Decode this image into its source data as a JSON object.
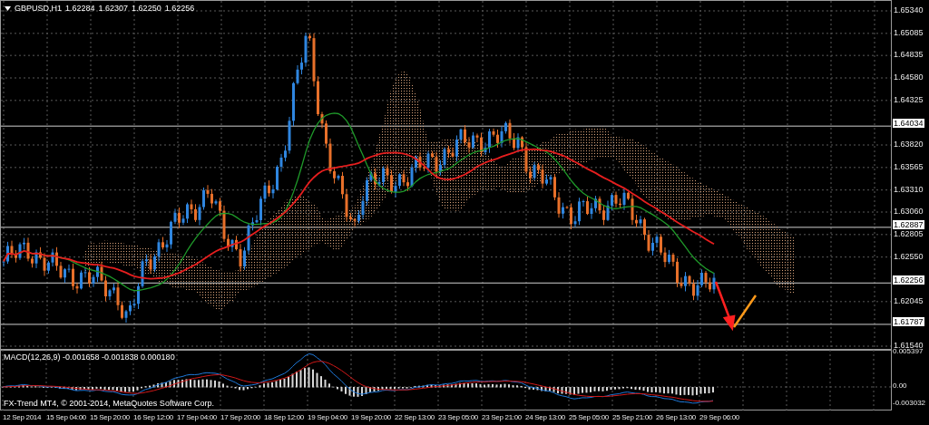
{
  "chart": {
    "symbol": "GBPUSD,H1",
    "quotes": [
      "1.62284",
      "1.62307",
      "1.62250",
      "1.62256"
    ]
  },
  "price_axis": {
    "labels": [
      "1.65340",
      "1.65085",
      "1.64835",
      "1.64580",
      "1.64325",
      "1.63820",
      "1.63565",
      "1.63310",
      "1.63060",
      "1.62805",
      "1.62550",
      "1.62045",
      "1.61540"
    ],
    "marked_levels": [
      "1.64034",
      "1.62887",
      "1.62256",
      "1.61787"
    ]
  },
  "macd": {
    "label": "MACD(12,26,9) -0.001658 -0.001838 0.000180",
    "axis_labels": [
      "0.005397",
      "0.00",
      "-0.003032"
    ]
  },
  "copyright": "FX-Trend MT4, © 2001-2014, MetaQuotes Software Corp.",
  "time_axis": [
    "12 Sep 2014",
    "15 Sep 04:00",
    "15 Sep 20:00",
    "16 Sep 12:00",
    "17 Sep 04:00",
    "17 Sep 20:00",
    "18 Sep 12:00",
    "19 Sep 04:00",
    "19 Sep 20:00",
    "22 Sep 13:00",
    "23 Sep 05:00",
    "23 Sep 21:00",
    "24 Sep 13:00",
    "25 Sep 05:00",
    "25 Sep 21:00",
    "26 Sep 13:00",
    "29 Sep 06:00"
  ]
}
